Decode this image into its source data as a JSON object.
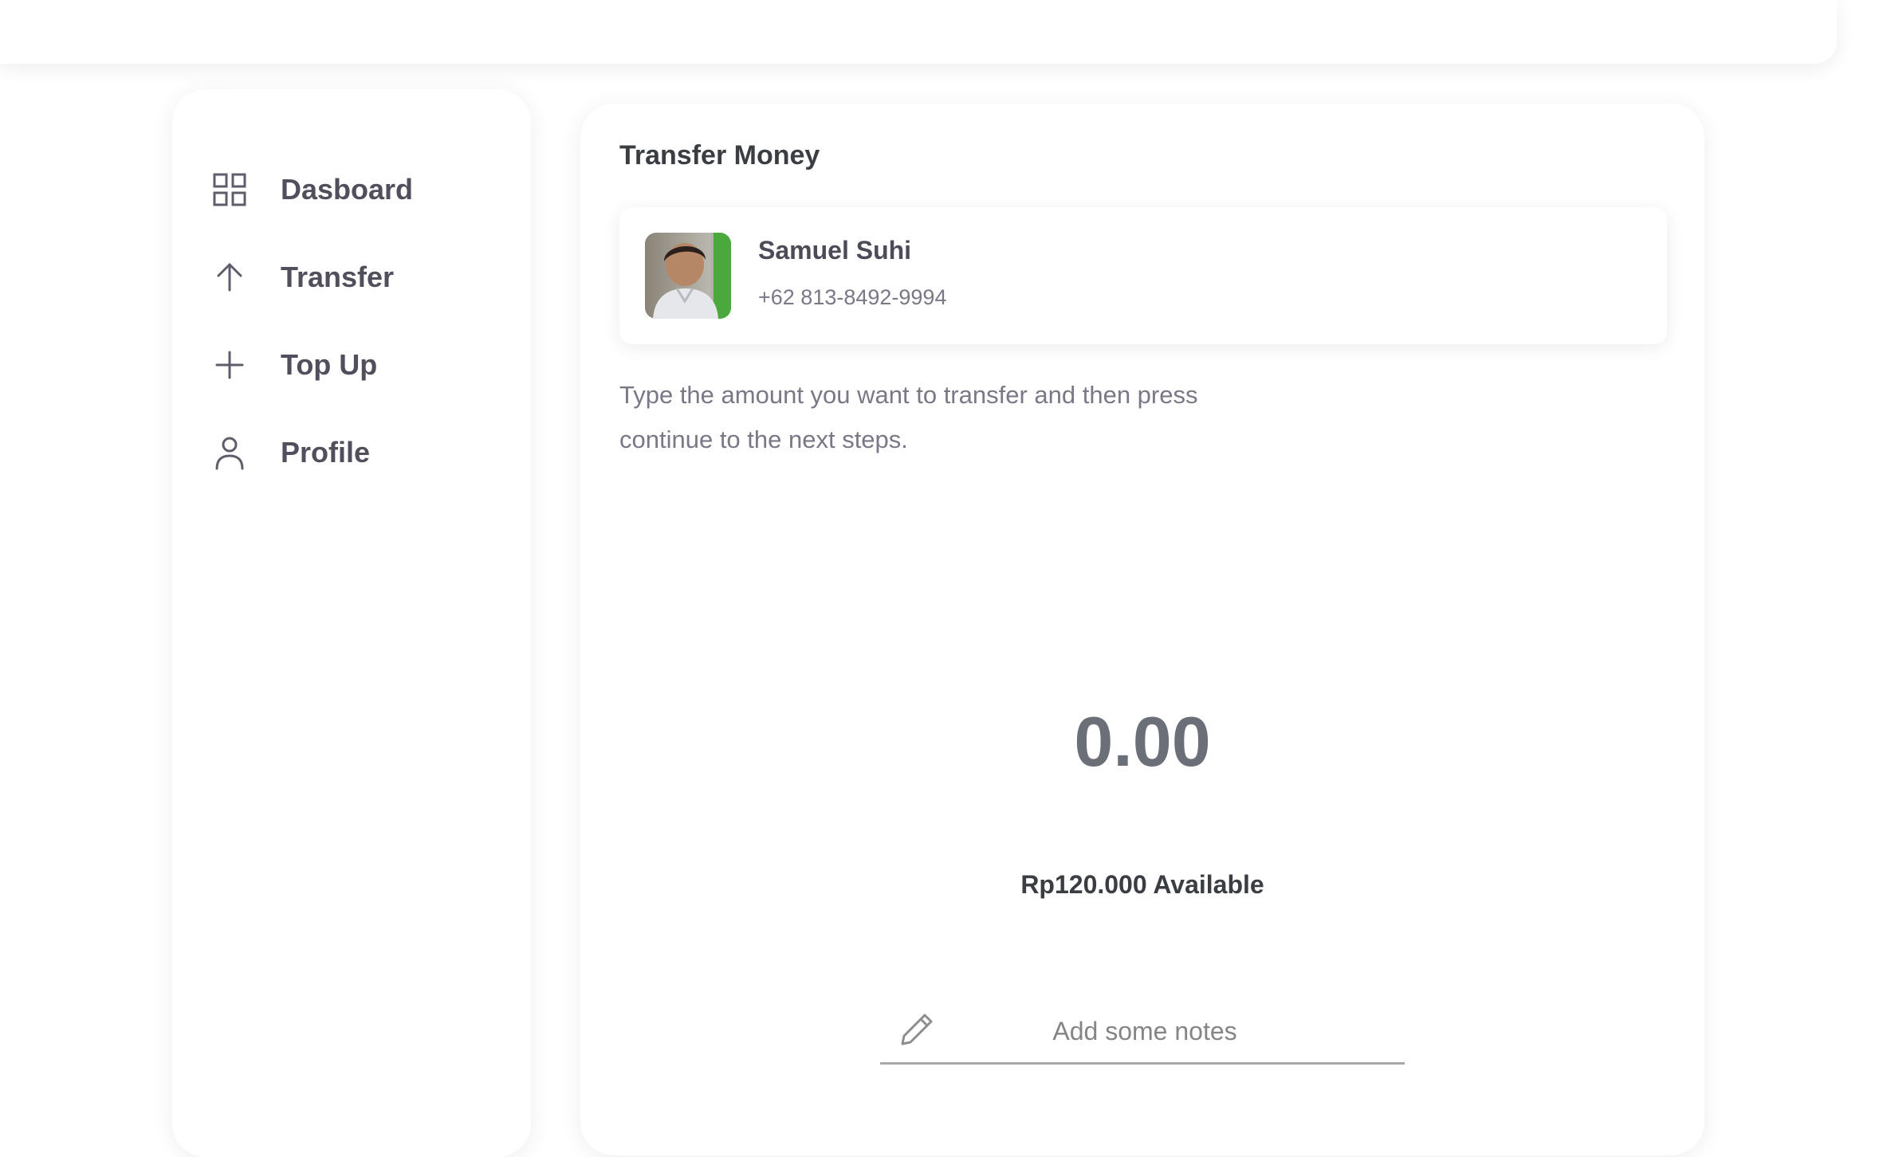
{
  "sidebar": {
    "items": [
      {
        "label": "Dasboard",
        "icon": "grid-icon"
      },
      {
        "label": "Transfer",
        "icon": "arrow-up-icon"
      },
      {
        "label": "Top Up",
        "icon": "plus-icon"
      },
      {
        "label": "Profile",
        "icon": "user-icon"
      }
    ]
  },
  "main": {
    "title": "Transfer Money",
    "contact": {
      "name": "Samuel Suhi",
      "phone": "+62 813-8492-9994"
    },
    "instruction": "Type the amount you want to transfer and then press continue to the next steps.",
    "amount": "0.00",
    "available": "Rp120.000 Available",
    "notes_placeholder": "Add some notes"
  },
  "colors": {
    "text_dark": "#3a3d42",
    "text_muted": "#7a7886",
    "amount": "#6a6f78",
    "background": "#ffffff"
  }
}
